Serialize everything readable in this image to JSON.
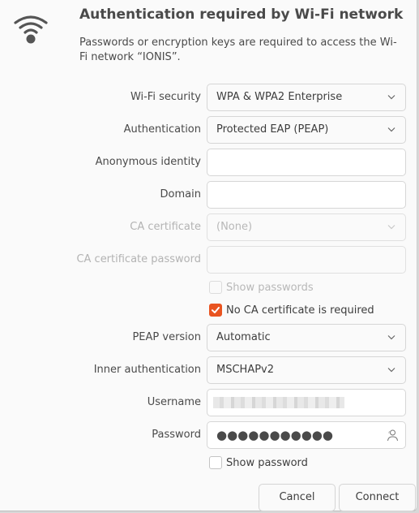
{
  "dialog": {
    "title": "Authentication required by Wi-Fi network",
    "description": "Passwords or encryption keys are required to access the Wi-Fi network “IONIS”.",
    "icon": "wifi-icon"
  },
  "form": {
    "wifi_security": {
      "label": "Wi-Fi security",
      "value": "WPA & WPA2 Enterprise"
    },
    "authentication": {
      "label": "Authentication",
      "value": "Protected EAP (PEAP)"
    },
    "anonymous_identity": {
      "label": "Anonymous identity",
      "value": ""
    },
    "domain": {
      "label": "Domain",
      "value": ""
    },
    "ca_certificate": {
      "label": "CA certificate",
      "value": "(None)",
      "disabled": true
    },
    "ca_certificate_password": {
      "label": "CA certificate password",
      "value": "",
      "disabled": true
    },
    "show_passwords": {
      "label": "Show passwords",
      "checked": false,
      "disabled": true
    },
    "no_ca_required": {
      "label": "No CA certificate is required",
      "checked": true
    },
    "peap_version": {
      "label": "PEAP version",
      "value": "Automatic"
    },
    "inner_authentication": {
      "label": "Inner authentication",
      "value": "MSCHAPv2"
    },
    "username": {
      "label": "Username",
      "value": "(redacted)"
    },
    "password": {
      "label": "Password",
      "value": "●●●●●●●●●●●",
      "icon": "user-icon"
    },
    "show_password": {
      "label": "Show password",
      "checked": false
    }
  },
  "buttons": {
    "cancel": "Cancel",
    "connect": "Connect"
  },
  "colors": {
    "accent": "#e95420",
    "background": "#fafafa",
    "disabled_text": "#b8b8b8"
  }
}
